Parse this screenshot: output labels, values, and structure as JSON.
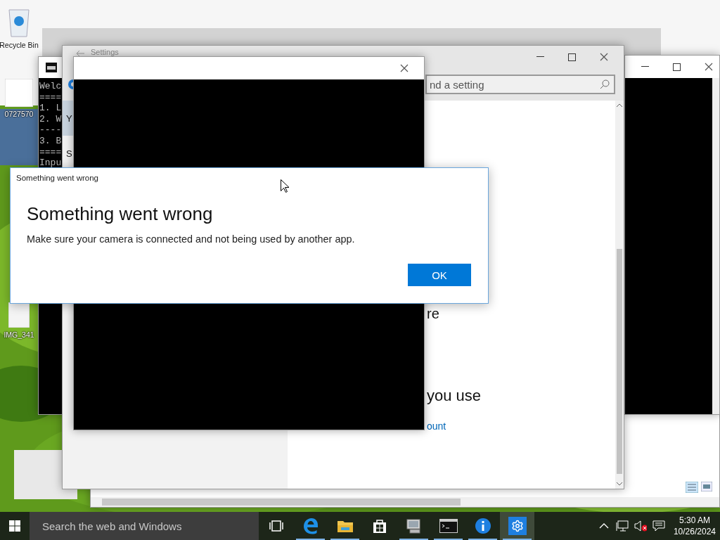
{
  "desktop_icons": [
    {
      "kind": "bin",
      "label": "Recycle Bin"
    },
    {
      "label": "0727570"
    },
    {
      "kind": "document",
      "label": "IMG_341"
    }
  ],
  "console_window": {
    "lines": [
      "Welc",
      "====",
      "1. L",
      "2. W",
      "----",
      "3. B",
      "====",
      "Inpu"
    ]
  },
  "settings_window": {
    "title": "Settings",
    "search": {
      "placeholder": "nd a setting"
    },
    "nav": [
      {
        "label": "Y",
        "selected": true
      },
      {
        "label": "S",
        "selected": false
      }
    ],
    "content": [
      {
        "kind": "text",
        "text": "re"
      },
      {
        "kind": "heading",
        "text": "you use"
      },
      {
        "kind": "link",
        "text": "ount"
      }
    ]
  },
  "dialog": {
    "title": "Something went wrong",
    "heading": "Something went wrong",
    "message": "Make sure your camera is connected and not being used by another app.",
    "buttons": [
      "OK"
    ]
  },
  "taskbar": {
    "search": {
      "placeholder": "Search the web and Windows"
    },
    "apps": [
      {
        "kind": "taskview",
        "running": false,
        "selected": false
      },
      {
        "kind": "edge",
        "running": true,
        "selected": false
      },
      {
        "kind": "explorer",
        "running": true,
        "selected": false
      },
      {
        "kind": "store",
        "running": false,
        "selected": false
      },
      {
        "kind": "monitor",
        "running": true,
        "selected": false
      },
      {
        "kind": "console",
        "running": true,
        "selected": false
      },
      {
        "kind": "info",
        "running": true,
        "selected": false
      },
      {
        "kind": "settings",
        "running": true,
        "selected": true
      }
    ],
    "tray": {
      "volume": {
        "muted": true
      },
      "time": "5:30 AM",
      "date": "10/26/2024"
    }
  }
}
